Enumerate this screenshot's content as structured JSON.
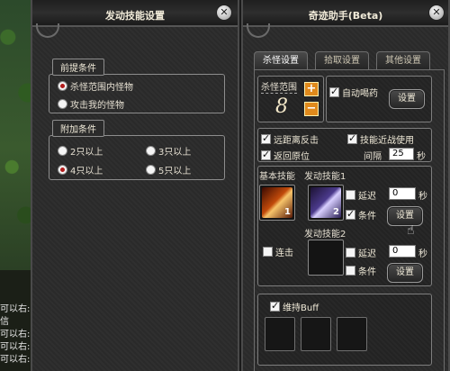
{
  "chat": {
    "lines": [
      "可以右:",
      "信",
      "可以右:",
      "可以右:",
      "可以右:"
    ]
  },
  "skill_settings": {
    "title": "发动技能设置",
    "precondition_label": "前提条件",
    "precondition_options": [
      "杀怪范围内怪物",
      "攻击我的怪物"
    ],
    "precondition_selected": 0,
    "extra_label": "附加条件",
    "extra_options": [
      "2只以上",
      "3只以上",
      "4只以上",
      "5只以上"
    ],
    "extra_selected": 2,
    "close": "✕"
  },
  "assistant": {
    "title": "奇迹助手(Beta)",
    "close": "✕",
    "tabs": [
      "杀怪设置",
      "拾取设置",
      "其他设置"
    ],
    "active_tab": 0,
    "range_label": "杀怪范围",
    "range_value": "8",
    "plus": "+",
    "minus": "−",
    "auto_potion": "自动喝药",
    "settings_btn": "设置",
    "ranged_counter": "远距离反击",
    "skill_combo": "技能近战使用",
    "return_origin": "返回原位",
    "interval_label": "间隔",
    "interval_value": "25",
    "seconds": "秒",
    "basic_skill": "基本技能",
    "active_skill1": "发动技能1",
    "active_skill2": "发动技能2",
    "delay": "延迟",
    "condition": "条件",
    "delay_value1": "0",
    "delay_value2": "0",
    "combo": "连击",
    "maintain_buff": "维持Buff",
    "badge1": "1",
    "badge2": "2",
    "colors": {
      "accent": "#e08a1c",
      "bg": "#2b2b2b"
    }
  }
}
